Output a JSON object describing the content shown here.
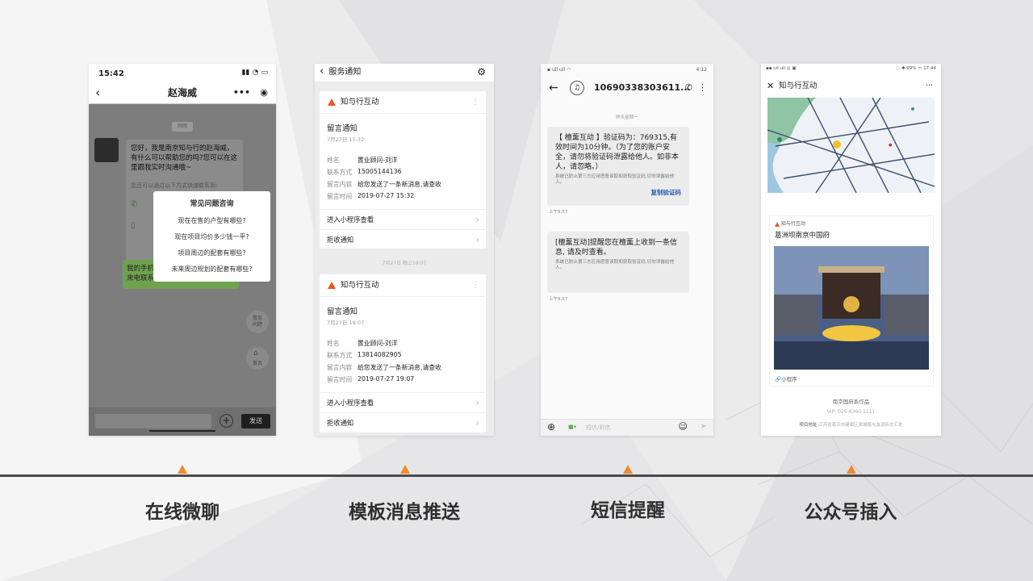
{
  "colors": {
    "accent": "#f08a2c",
    "brand": "#e8591c",
    "link": "#2a62b8",
    "wechat_green": "#95ec69"
  },
  "labels": [
    "在线微聊",
    "模板消息推送",
    "短信提醒",
    "公众号插入"
  ],
  "p1": {
    "time": "15:42",
    "title": "赵海威",
    "date_chip": "刚刚",
    "greeting": "您好，我是南京知与行的赵海威，有什么可以帮助您的吗?您可以在这里跟我实时沟通哦~",
    "hint": "您还可以通过以下方式快速联系到:",
    "green_msg_a": "我的手机",
    "green_msg_b": "来电联系",
    "popup_title": "常见问题咨询",
    "questions": [
      "现在在售的户型有哪些?",
      "现在项目均价多少钱一平?",
      "项目周边的配套有哪些?",
      "未来周边规划的配套有哪些?"
    ],
    "side_btn1": "常见\n问题",
    "side_btn2": "首页",
    "send": "发送"
  },
  "p2": {
    "title": "服务通知",
    "divider": "7月27日 晚上19:07",
    "cards": [
      {
        "brand": "知与行互动",
        "title": "留言通知",
        "date": "7月27日 15:32",
        "rows": [
          [
            "姓名",
            "置业顾问-刘洋"
          ],
          [
            "联系方式",
            "15005144136"
          ],
          [
            "留言内容",
            "给您发送了一条新消息,请查收"
          ],
          [
            "留言时间",
            "2019-07-27 15:32"
          ]
        ],
        "act1": "进入小程序查看",
        "act2": "拒收通知"
      },
      {
        "brand": "知与行互动",
        "title": "留言通知",
        "date": "7月27日 19:07",
        "rows": [
          [
            "姓名",
            "置业顾问-刘洋"
          ],
          [
            "联系方式",
            "13814082905"
          ],
          [
            "留言内容",
            "给您发送了一条新消息,请查收"
          ],
          [
            "留言时间",
            "2019-07-27 19:07"
          ]
        ],
        "act1": "进入小程序查看",
        "act2": "拒收通知"
      }
    ]
  },
  "p3": {
    "status_time": "4:12",
    "number": "10690338303611...",
    "date_header": "昨天星期一",
    "msg1": "【 檀薰互动 】验证码为：769315,有效时间为10分钟。（为了您的账户安全，请勿将验证码泄露给他人。如非本人，请忽略。）",
    "note1": "系统已防止第三方应用恶意读取和获取验证码,切勿泄露给他人。",
    "copy": "复制验证码",
    "time1": "上午9:57",
    "msg2": "[檀薰互动]提醒您在檀薰上收到一条信息, 请及时查看。",
    "note2": "系统已防止第三方应用恶意读取和获取验证码,切勿泄露给他人。",
    "time2": "上午9:57",
    "input_placeholder": "短信/彩信"
  },
  "p4": {
    "status_time": "17:44",
    "battery": "99%",
    "title": "知与行互动",
    "card_brand": "知与行互动",
    "card_title": "葛洲坝南京中国府",
    "mini": "小程序",
    "footer1": "南京国府系作品",
    "vip": "VIP: 025-8360 1111",
    "addr_label": "项目地址:",
    "addr": "江苏省南京市建邺区邺城路与友谊街交汇处"
  }
}
